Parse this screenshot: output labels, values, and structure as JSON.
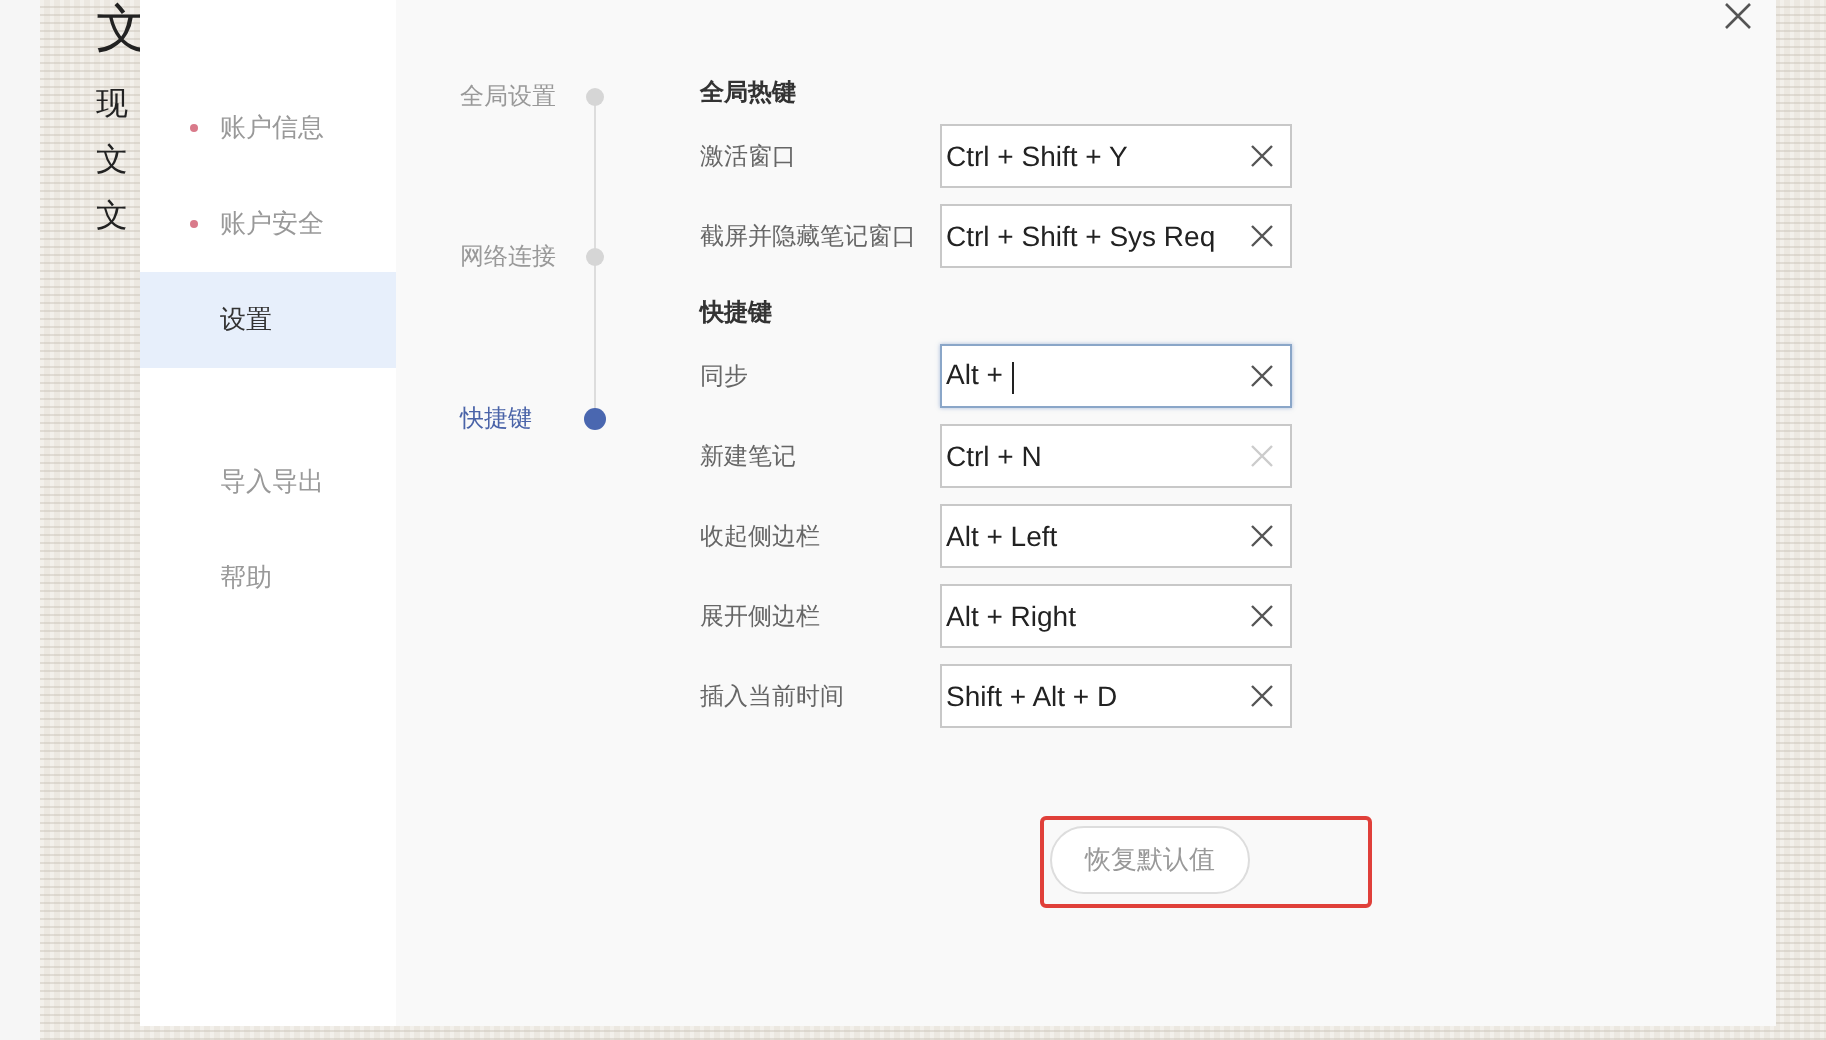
{
  "document_behind": {
    "title": "文",
    "lines": [
      "现",
      "文",
      "文"
    ]
  },
  "sidebar": {
    "items": [
      {
        "label": "账户信息",
        "dot": true,
        "selected": false
      },
      {
        "label": "账户安全",
        "dot": true,
        "selected": false
      },
      {
        "label": "设置",
        "dot": false,
        "selected": true
      },
      {
        "label": "导入导出",
        "dot": false,
        "selected": false
      },
      {
        "label": "帮助",
        "dot": false,
        "selected": false
      }
    ]
  },
  "steps": [
    {
      "label": "全局设置",
      "selected": false
    },
    {
      "label": "网络连接",
      "selected": false
    },
    {
      "label": "快捷键",
      "selected": true
    }
  ],
  "sections": [
    {
      "title": "全局热键",
      "rows": [
        {
          "label": "激活窗口",
          "value": "Ctrl + Shift + Y",
          "focused": false,
          "clear_disabled": false
        },
        {
          "label": "截屏并隐藏笔记窗口",
          "value": "Ctrl + Shift + Sys Req",
          "focused": false,
          "clear_disabled": false
        }
      ]
    },
    {
      "title": "快捷键",
      "rows": [
        {
          "label": "同步",
          "value": "Alt + ",
          "focused": true,
          "clear_disabled": false
        },
        {
          "label": "新建笔记",
          "value": "Ctrl + N",
          "focused": false,
          "clear_disabled": true
        },
        {
          "label": "收起侧边栏",
          "value": "Alt + Left",
          "focused": false,
          "clear_disabled": false
        },
        {
          "label": "展开侧边栏",
          "value": "Alt + Right",
          "focused": false,
          "clear_disabled": false
        },
        {
          "label": "插入当前时间",
          "value": "Shift + Alt + D",
          "focused": false,
          "clear_disabled": false
        }
      ]
    }
  ],
  "restore_button": {
    "label": "恢复默认值",
    "highlighted": true
  }
}
